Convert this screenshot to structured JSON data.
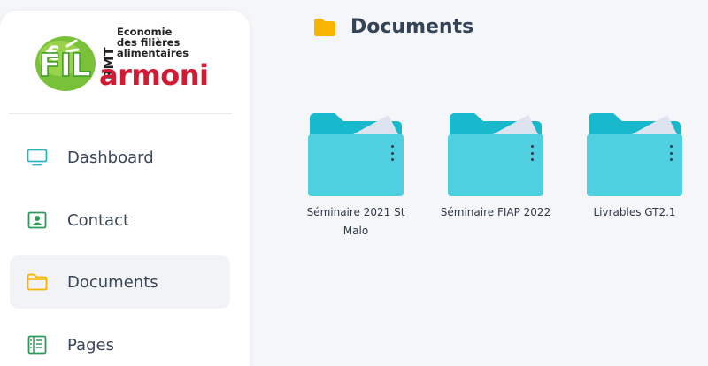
{
  "brand": {
    "fil": "FIL",
    "armoni": "armoni",
    "rmt": "RMT",
    "tagline_lines": [
      "Economie",
      "des filières",
      "alimentaires"
    ]
  },
  "sidebar": {
    "items": [
      {
        "label": "Dashboard",
        "icon": "monitor-icon",
        "active": false
      },
      {
        "label": "Contact",
        "icon": "contact-card-icon",
        "active": false
      },
      {
        "label": "Documents",
        "icon": "folder-outline-icon",
        "active": true
      },
      {
        "label": "Pages",
        "icon": "pages-icon",
        "active": false
      }
    ]
  },
  "main": {
    "title": "Documents",
    "title_icon": "folder-icon",
    "folders": [
      {
        "name": "Séminaire 2021 St Malo"
      },
      {
        "name": "Séminaire FIAP 2022"
      },
      {
        "name": "Livrables GT2.1"
      }
    ]
  },
  "colors": {
    "folder_body": "#4fd0e0",
    "folder_tab": "#18b8cd",
    "folder_paper": "#dde4f0",
    "header_folder": "#f7b400",
    "accent_documents": "#f7b400",
    "dashboard_icon": "#28b6c8",
    "contact_icon": "#2d9a5a",
    "pages_icon": "#2d9a5a",
    "brand_green": "#3a9a25",
    "brand_red": "#cf1b33"
  }
}
